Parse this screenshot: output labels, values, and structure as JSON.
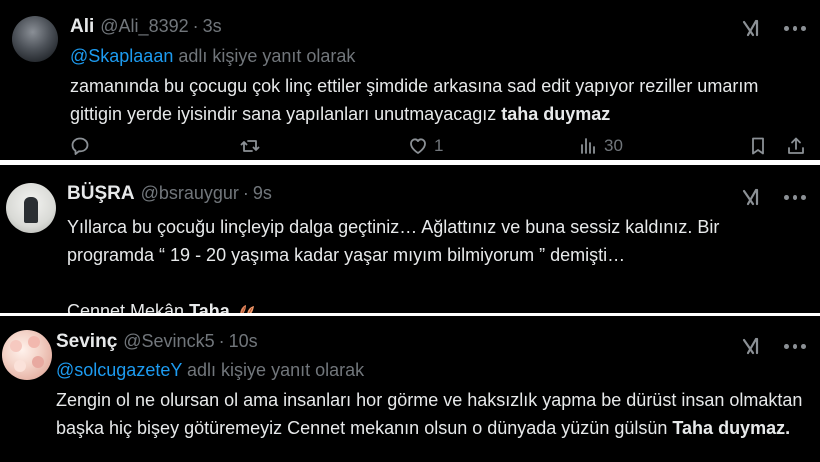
{
  "tweets": [
    {
      "name": "Ali",
      "handle": "@Ali_8392",
      "dot": "·",
      "time": "3s",
      "reply_mention": "@Skaplaaan",
      "reply_suffix": " adlı kişiye yanıt olarak",
      "text_plain": "zamanında bu çocugu çok linç ettiler şimdide arkasına sad edit yapıyor reziller umarım gittigin yerde iyisindir sana yapılanları unutmayacagız ",
      "text_bold": "taha duymaz",
      "like_count": "1",
      "view_count": "30",
      "icons": [
        "grok-icon",
        "more-icon",
        "reply-icon",
        "retweet-icon",
        "like-icon",
        "views-icon",
        "bookmark-icon",
        "share-icon"
      ]
    },
    {
      "name": "BÜŞRA",
      "handle": "@bsrauygur",
      "dot": "·",
      "time": "9s",
      "text_line1": "Yıllarca bu çocuğu linçleyip dalga geçtiniz… Ağlattınız ve buna sessiz kaldınız. Bir programda “ 19 - 20 yaşıma kadar yaşar mıyım bilmiyorum ” demişti…",
      "text_plain2": "Cennet Mekân ",
      "text_bold": "Taha",
      "icons": [
        "grok-icon",
        "more-icon",
        "leaf-emoji-icon"
      ]
    },
    {
      "name": "Sevinç",
      "handle": "@Sevinck5",
      "dot": "·",
      "time": "10s",
      "reply_mention": "@solcugazeteY",
      "reply_suffix": " adlı kişiye yanıt olarak",
      "text_plain": "Zengin ol ne olursan ol ama insanları hor görme ve haksızlık yapma be dürüst insan olmaktan başka hiç bişey götüremeyiz Cennet mekanın olsun o dünyada yüzün gülsün ",
      "text_bold": "Taha duymaz.",
      "icons": [
        "grok-icon",
        "more-icon"
      ]
    }
  ],
  "colors": {
    "background": "#000000",
    "text": "#e7e9ea",
    "muted": "#71767b",
    "mention": "#1d9bf0",
    "separator": "#ffffff"
  }
}
